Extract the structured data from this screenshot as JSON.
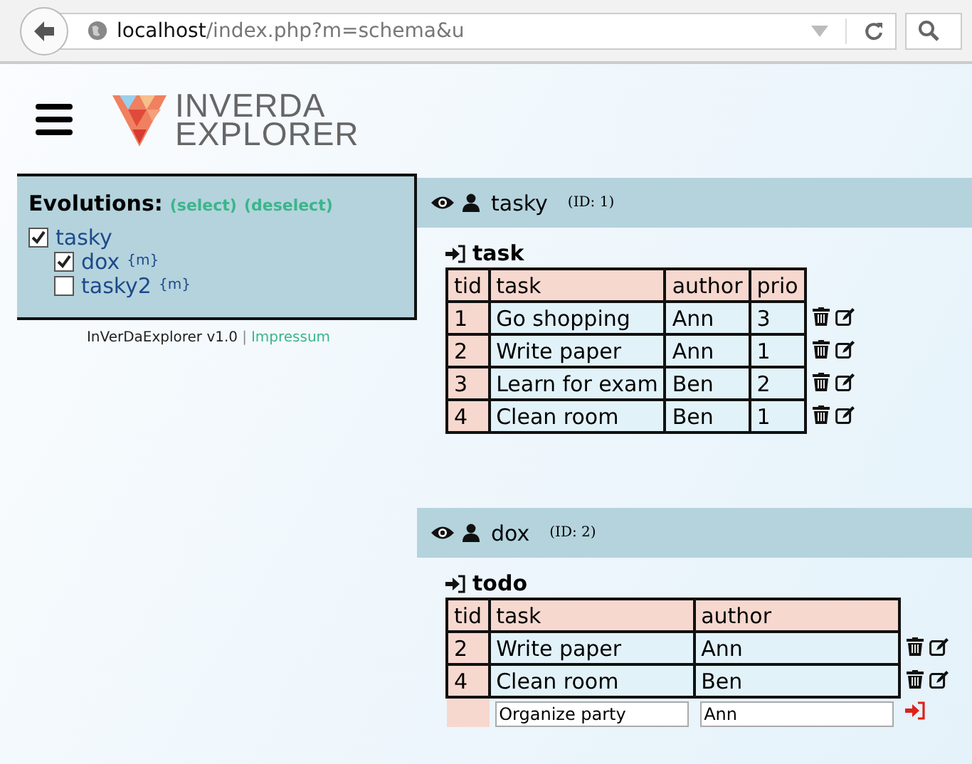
{
  "browser": {
    "host": "localhost",
    "path": "/index.php?m=schema&u"
  },
  "logo": {
    "line1": "INVERDA",
    "line2": "EXPLORER"
  },
  "evolutions": {
    "title": "Evolutions:",
    "select": "(select)",
    "deselect": "(deselect)",
    "tree": [
      {
        "label": "tasky",
        "checked": true,
        "children": [
          {
            "label": "dox",
            "tag": "{m}",
            "checked": true
          },
          {
            "label": "tasky2",
            "tag": "{m}",
            "checked": false
          }
        ]
      }
    ]
  },
  "footer": {
    "name": "InVerDaExplorer v1.0",
    "separator": "|",
    "link": "Impressum"
  },
  "schemas": [
    {
      "name": "tasky",
      "id": "(ID: 1)",
      "table": {
        "name": "task",
        "columns": [
          "tid",
          "task",
          "author",
          "prio"
        ],
        "rows": [
          [
            "1",
            "Go shopping",
            "Ann",
            "3"
          ],
          [
            "2",
            "Write paper",
            "Ann",
            "1"
          ],
          [
            "3",
            "Learn for exam",
            "Ben",
            "2"
          ],
          [
            "4",
            "Clean room",
            "Ben",
            "1"
          ]
        ]
      }
    },
    {
      "name": "dox",
      "id": "(ID: 2)",
      "table": {
        "name": "todo",
        "columns": [
          "tid",
          "task",
          "author"
        ],
        "rows": [
          [
            "2",
            "Write paper",
            "Ann"
          ],
          [
            "4",
            "Clean room",
            "Ben"
          ]
        ],
        "new_row": [
          "Organize party",
          "Ann"
        ]
      }
    }
  ]
}
